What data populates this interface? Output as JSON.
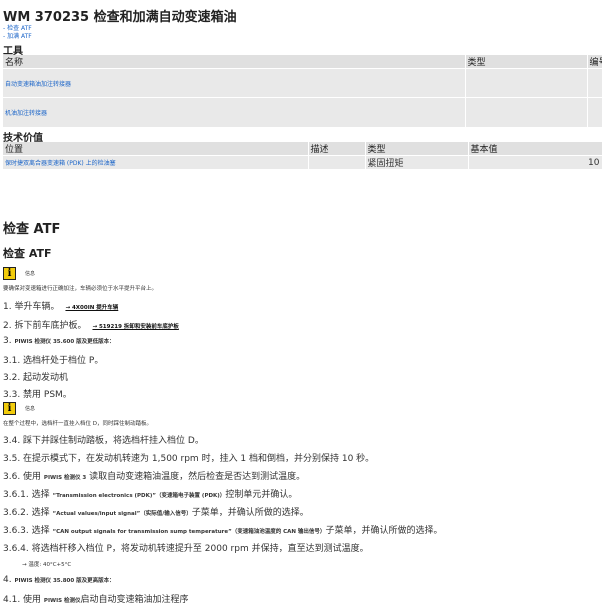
{
  "title": "WM 370235 检查和加满自动变速箱油",
  "toc": [
    "- 检查 ATF",
    "- 加满 ATF"
  ],
  "tools": {
    "heading": "工具",
    "headers": [
      "名称",
      "类型",
      "编号"
    ],
    "rows": [
      {
        "name": "自动变速箱油加注转接器"
      },
      {
        "name": "机油加注转接器"
      }
    ]
  },
  "tech": {
    "heading": "技术价值",
    "headers": [
      "位置",
      "描述",
      "类型",
      "基本值"
    ],
    "rows": [
      {
        "location": "保时捷双离合器变速箱 (PDK) 上的检油塞",
        "type": "紧固扭矩",
        "value": "10"
      }
    ]
  },
  "section": {
    "heading": "检查 ATF",
    "subheading": "检查 ATF",
    "info_label": "信息",
    "info_icon": "i",
    "note1": "要确保对变速箱进行正确加注，车辆必须位于水平提升平台上。",
    "note2": "在整个过程中，选档杆一直挂入档位 D，同时踩住制动踏板。",
    "steps": {
      "s1": {
        "text": "1. 举升车辆。",
        "ref": "→ 4X00IN 提升车辆"
      },
      "s2": {
        "text": "2. 拆下前车底护板。",
        "ref": "→ 519219 拆卸和安装前车底护板"
      },
      "s3": {
        "text": "3.",
        "small": "PIWIS 检测仪 35.600 版及更低版本："
      },
      "s31": "3.1. 选档杆处于档位 P。",
      "s32": "3.2. 起动发动机",
      "s33": "3.3. 禁用 PSM。",
      "s34": "3.4. 踩下并踩住制动踏板，将选档杆挂入档位 D。",
      "s35": "3.5. 在提示模式下，在发动机转速为 1,500 rpm 时，挂入 1 档和倒档，并分别保持 10 秒。",
      "s36": {
        "pre": "3.6. 使用",
        "small": "PIWIS 检测仪 3",
        "post": "读取自动变速箱油温度，然后检查是否达到测试温度。"
      },
      "s361": {
        "pre": "3.6.1. 选择",
        "small": "“Transmission electronics (PDK)”（变速箱电子装置 (PDK)）",
        "post": "控制单元并确认。"
      },
      "s362": {
        "pre": "3.6.2. 选择",
        "small": "“Actual values/input signal”（实际值/输入信号）",
        "post": "子菜单，并确认所做的选择。"
      },
      "s363": {
        "pre": "3.6.3. 选择",
        "small": "“CAN output signals for transmission sump temperature”（变速箱油池温度的 CAN 输出信号）",
        "post": "子菜单，并确认所做的选择。"
      },
      "s364": "3.6.4. 将选档杆移入档位 P，将发动机转速提升至 2000 rpm 并保持，直至达到测试温度。",
      "s364b": "→ 温度: 40°C+5°C",
      "s4": {
        "text": "4.",
        "small": "PIWIS 检测仪 35.800 版及更高版本："
      },
      "s41": {
        "pre": "4.1. 使用",
        "small": "PIWIS 检测仪",
        "post": "启动自动变速箱油加注程序"
      }
    }
  }
}
